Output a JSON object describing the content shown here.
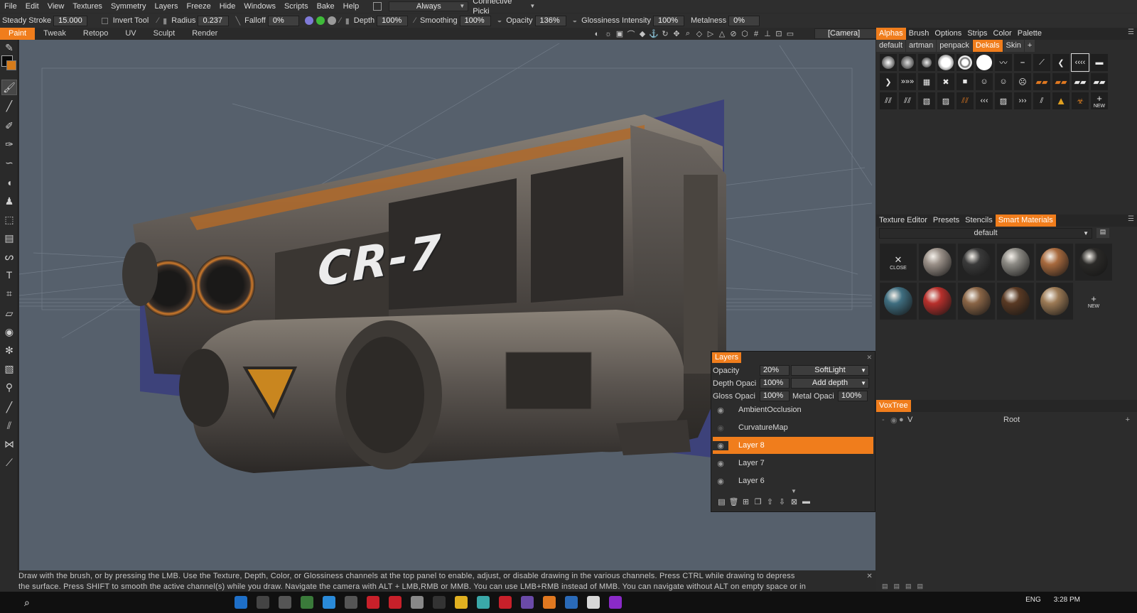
{
  "menubar": {
    "items": [
      "File",
      "Edit",
      "View",
      "Textures",
      "Symmetry",
      "Layers",
      "Freeze",
      "Hide",
      "Windows",
      "Scripts",
      "Bake",
      "Help"
    ],
    "always_dropdown": "Always",
    "pick_dropdown": "Connective Picki"
  },
  "toolbar": {
    "steady_stroke_label": "Steady Stroke",
    "steady_stroke_value": "15.000",
    "invert_tool_label": "Invert Tool",
    "radius_label": "Radius",
    "radius_value": "0.237",
    "falloff_label": "Falloff",
    "falloff_value": "0%",
    "depth_label": "Depth",
    "depth_value": "100%",
    "smoothing_label": "Smoothing",
    "smoothing_value": "100%",
    "opacity_label": "Opacity",
    "opacity_value": "136%",
    "gloss_label": "Glossiness Intensity",
    "gloss_value": "100%",
    "metalness_label": "Metalness",
    "metalness_value": "0%"
  },
  "rooms": {
    "tabs": [
      "Paint",
      "Tweak",
      "Retopo",
      "UV",
      "Sculpt",
      "Render"
    ],
    "active": "Paint",
    "camera": "[Camera]"
  },
  "viewport": {
    "model_label": "CR-7"
  },
  "status": {
    "line1": "Draw with the brush, or by pressing the LMB. Use the Texture, Depth, Color, or Glossiness channels at the top panel to enable, adjust, or disable drawing in the various channels. Press CTRL while drawing to depress",
    "line2": "the surface. Press SHIFT to smooth the active channel(s) while you draw. Navigate the camera with ALT + LMB,RMB or MMB. You can use LMB+RMB instead of MMB. You can navigate without ALT on empty space or in"
  },
  "alphas_panel": {
    "tabs": [
      "Alphas",
      "Brush",
      "Options",
      "Strips",
      "Color",
      "Palette"
    ],
    "active": "Alphas",
    "sets": [
      "default",
      "artman",
      "penpack",
      "Dekals",
      "Skin"
    ],
    "active_set": "Dekals",
    "new_label": "NEW"
  },
  "materials_panel": {
    "tabs": [
      "Texture Editor",
      "Presets",
      "Stencils",
      "Smart Materials"
    ],
    "active": "Smart Materials",
    "folder": "default",
    "close_label": "CLOSE",
    "new_label": "NEW",
    "materials": [
      {
        "color": "#9a9088"
      },
      {
        "color": "#3a3a3a"
      },
      {
        "color": "#8c8a84"
      },
      {
        "color": "#a86a3e"
      },
      {
        "color": "#2b2a28"
      },
      {
        "color": "#3f6e80"
      },
      {
        "color": "#b8302c"
      },
      {
        "color": "#8a6546"
      },
      {
        "color": "#5a3a24"
      },
      {
        "color": "#9c7a55"
      }
    ]
  },
  "layers_panel": {
    "title": "Layers",
    "opacity_label": "Opacity",
    "opacity_value": "20%",
    "blend_mode": "SoftLight",
    "depth_label": "Depth Opaci",
    "depth_value": "100%",
    "depth_mode": "Add depth",
    "gloss_label": "Gloss Opaci",
    "gloss_value": "100%",
    "metal_label": "Metal Opaci",
    "metal_value": "100%",
    "items": [
      "AmbientOcclusion",
      "CurvatureMap",
      "Layer 8",
      "Layer 7",
      "Layer 6"
    ],
    "active": "Layer 8"
  },
  "voxtree": {
    "title": "VoxTree",
    "root_label": "Root",
    "root_flag": "V"
  },
  "system": {
    "language": "ENG",
    "time": "3:28 PM"
  },
  "colors": {
    "accent": "#f07d1c",
    "viewport_bg": "#56606c",
    "panel_bg": "#2c2c2c"
  }
}
